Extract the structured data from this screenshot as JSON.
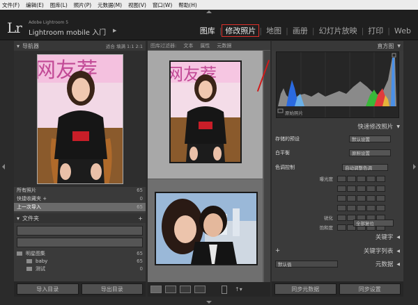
{
  "menu": [
    "文件(F)",
    "编辑(E)",
    "图库(L)",
    "照片(P)",
    "元数据(M)",
    "视图(V)",
    "窗口(W)",
    "帮助(H)"
  ],
  "app": {
    "logo": "Lr",
    "version": "Adobe Lightroom 5",
    "name": "Lightroom mobile 入门",
    "arrow": "▶"
  },
  "modules": [
    "图库",
    "修改照片",
    "地图",
    "画册",
    "幻灯片放映",
    "打印",
    "Web"
  ],
  "left": {
    "navigator_title": "导航器",
    "nav_options": "适合  填满  1:1  2:1",
    "catalog": [
      {
        "label": "所有照片",
        "count": "65"
      },
      {
        "label": "快捷收藏夹 +",
        "count": "0"
      },
      {
        "label": "上一次导入",
        "count": "65"
      }
    ],
    "folders_title": "文件夹",
    "folders_plus": "+",
    "folders": [
      {
        "label": "明星图集",
        "count": "65"
      },
      {
        "label": "baby",
        "count": "65"
      },
      {
        "label": "测试",
        "count": "0"
      }
    ],
    "import_button": "导入目录",
    "export_button": "导出目录"
  },
  "center": {
    "filter_label": "图库过滤器:",
    "filters": [
      "文本",
      "属性",
      "元数据"
    ]
  },
  "right": {
    "histogram_title": "直方图",
    "original_photo": "原始照片",
    "quick_develop_title": "快速修改照片",
    "saved_preset_label": "存储的预设",
    "saved_preset_value": "默认设置",
    "white_balance_label": "白平衡",
    "white_balance_value": "原照设置",
    "tone_label": "色调控制",
    "auto_tone": "自动调整色调",
    "tone_rows": [
      "曝光度",
      "",
      "",
      "",
      "锐化",
      "饱和度"
    ],
    "reset_all": "全部复位",
    "keywords_title": "关键字",
    "keyword_list_title": "关键字列表",
    "plus": "+",
    "metadata_select": "默认值",
    "metadata_title": "元数据",
    "sync_metadata": "同步元数据",
    "sync_settings": "同步设置"
  },
  "colors": {
    "highlight_red": "#e0302a",
    "panel_bg": "#3a3a3a"
  }
}
